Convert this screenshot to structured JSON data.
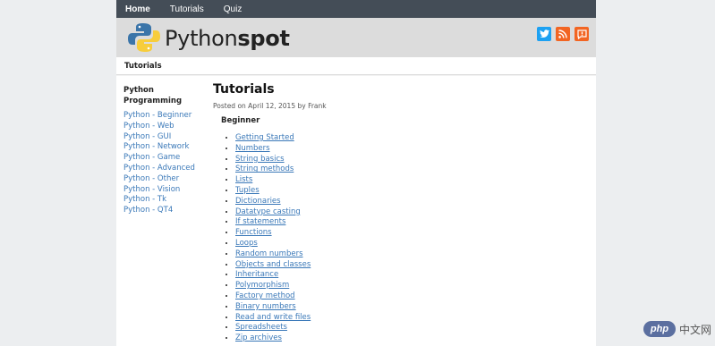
{
  "topnav": {
    "items": [
      "Home",
      "Tutorials",
      "Quiz"
    ]
  },
  "brand": {
    "part1": "Python",
    "part2": "spot"
  },
  "social": {
    "icons": [
      "twitter-icon",
      "rss-icon",
      "feedback-icon"
    ],
    "colors": [
      "#1da1f2",
      "#f26522",
      "#f26522"
    ]
  },
  "breadcrumb": {
    "label": "Tutorials"
  },
  "sidebar": {
    "title": "Python Programming",
    "items": [
      "Python - Beginner",
      "Python - Web",
      "Python - GUI",
      "Python - Network",
      "Python - Game",
      "Python - Advanced",
      "Python - Other",
      "Python - Vision",
      "Python - Tk",
      "Python - QT4"
    ]
  },
  "main": {
    "title": "Tutorials",
    "meta": "Posted on April 12, 2015 by Frank",
    "section": "Beginner",
    "tutorials": [
      "Getting Started",
      "Numbers",
      "String basics",
      "String methods",
      "Lists",
      "Tuples",
      "Dictionaries",
      "Datatype casting",
      "If statements",
      "Functions",
      "Loops",
      "Random numbers",
      "Objects and classes",
      "Inheritance",
      "Polymorphism",
      "Factory method",
      "Binary numbers",
      "Read and write files",
      "Spreadsheets",
      "Zip archives"
    ]
  },
  "watermark": {
    "badge": "php",
    "text": "中文网"
  }
}
